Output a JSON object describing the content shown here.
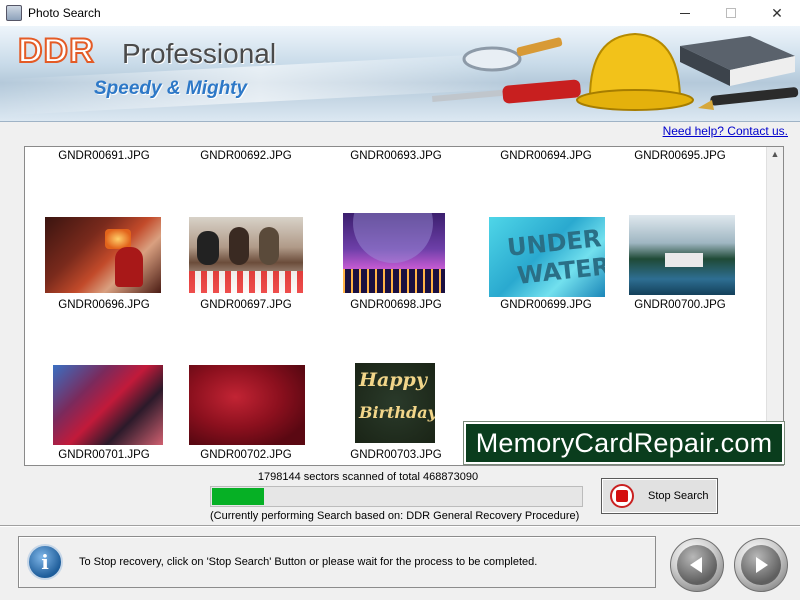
{
  "window": {
    "title": "Photo Search",
    "controls": {
      "minimize": "—",
      "close": "✕"
    }
  },
  "banner": {
    "logo": "DDR",
    "product": "Professional",
    "tagline": "Speedy & Mighty"
  },
  "help_link": "Need help? Contact us.",
  "gallery": {
    "row1": [
      "GNDR00691.JPG",
      "GNDR00692.JPG",
      "GNDR00693.JPG",
      "GNDR00694.JPG",
      "GNDR00695.JPG"
    ],
    "row2": [
      "GNDR00696.JPG",
      "GNDR00697.JPG",
      "GNDR00698.JPG",
      "GNDR00699.JPG",
      "GNDR00700.JPG"
    ],
    "row3": [
      "GNDR00701.JPG",
      "GNDR00702.JPG",
      "GNDR00703.JPG"
    ],
    "thumb_text": {
      "underwater_line1": "UNDER",
      "underwater_line2": "WATER",
      "birthday_line1": "Happy",
      "birthday_line2": "Birthday"
    }
  },
  "watermark": "MemoryCardRepair.com",
  "scan": {
    "status": "1798144 sectors scanned of total 468873090",
    "progress_fraction": 0.14,
    "procedure": "(Currently performing Search based on:  DDR General Recovery Procedure)"
  },
  "stop_button": "Stop Search",
  "info": "To Stop recovery, click on 'Stop Search' Button or please wait for the process to be completed.",
  "colors": {
    "progress": "#06b025",
    "link": "#0000cc",
    "logo_orange": "#e45b26",
    "tagline_blue": "#2d78c7"
  },
  "icons": {
    "info": "info-icon",
    "back": "arrow-left-icon",
    "next": "arrow-right-icon",
    "stop": "stop-icon"
  }
}
